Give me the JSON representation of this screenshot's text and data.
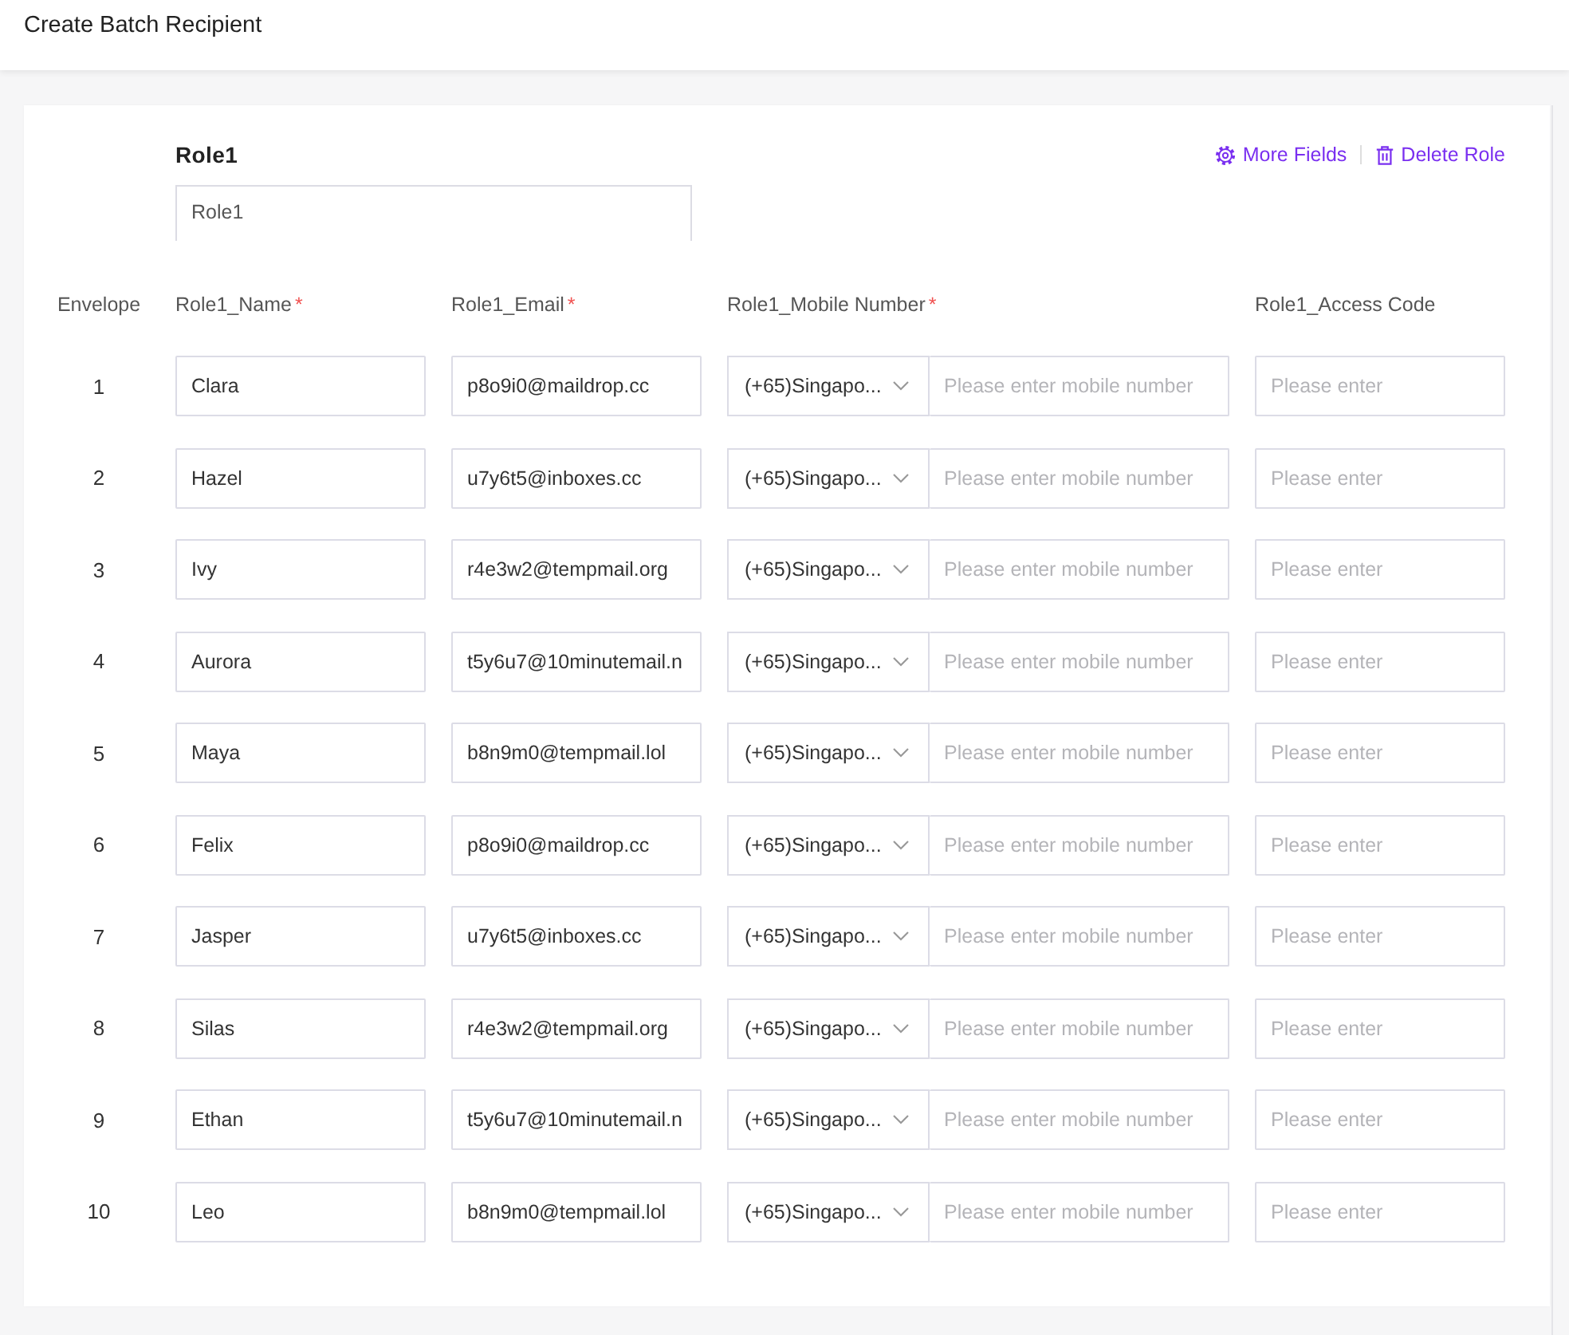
{
  "header": {
    "title": "Create Batch Recipient"
  },
  "role": {
    "label": "Role1",
    "name_field": {
      "value": "Role1"
    },
    "actions": [
      {
        "kind": "settings",
        "label": "More Fields"
      },
      {
        "kind": "delete",
        "label": "Delete Role"
      }
    ]
  },
  "table": {
    "columns": [
      {
        "label": "Envelope"
      },
      {
        "label": "Role1_Name",
        "required_mark": "*"
      },
      {
        "label": "Role1_Email",
        "required_mark": "*"
      },
      {
        "label": "Role1_Mobile Number",
        "required_mark": "*"
      },
      {
        "label": "Role1_Access Code"
      }
    ],
    "rows": [
      {
        "envelope": "1",
        "name": "Clara",
        "email": "p8o9i0@maildrop.cc",
        "country_code": "(+65)Singapo...",
        "mobile": {
          "placeholder": "Please enter mobile number"
        },
        "access_code": {
          "placeholder": "Please enter"
        }
      },
      {
        "envelope": "2",
        "name": "Hazel",
        "email": "u7y6t5@inboxes.cc",
        "country_code": "(+65)Singapo...",
        "mobile": {
          "placeholder": "Please enter mobile number"
        },
        "access_code": {
          "placeholder": "Please enter"
        }
      },
      {
        "envelope": "3",
        "name": "Ivy",
        "email": "r4e3w2@tempmail.org",
        "country_code": "(+65)Singapo...",
        "mobile": {
          "placeholder": "Please enter mobile number"
        },
        "access_code": {
          "placeholder": "Please enter"
        }
      },
      {
        "envelope": "4",
        "name": "Aurora",
        "email": "t5y6u7@10minutemail.n",
        "country_code": "(+65)Singapo...",
        "mobile": {
          "placeholder": "Please enter mobile number"
        },
        "access_code": {
          "placeholder": "Please enter"
        }
      },
      {
        "envelope": "5",
        "name": "Maya",
        "email": "b8n9m0@tempmail.lol",
        "country_code": "(+65)Singapo...",
        "mobile": {
          "placeholder": "Please enter mobile number"
        },
        "access_code": {
          "placeholder": "Please enter"
        }
      },
      {
        "envelope": "6",
        "name": "Felix",
        "email": "p8o9i0@maildrop.cc",
        "country_code": "(+65)Singapo...",
        "mobile": {
          "placeholder": "Please enter mobile number"
        },
        "access_code": {
          "placeholder": "Please enter"
        }
      },
      {
        "envelope": "7",
        "name": "Jasper",
        "email": "u7y6t5@inboxes.cc",
        "country_code": "(+65)Singapo...",
        "mobile": {
          "placeholder": "Please enter mobile number"
        },
        "access_code": {
          "placeholder": "Please enter"
        }
      },
      {
        "envelope": "8",
        "name": "Silas",
        "email": "r4e3w2@tempmail.org",
        "country_code": "(+65)Singapo...",
        "mobile": {
          "placeholder": "Please enter mobile number"
        },
        "access_code": {
          "placeholder": "Please enter"
        }
      },
      {
        "envelope": "9",
        "name": "Ethan",
        "email": "t5y6u7@10minutemail.n",
        "country_code": "(+65)Singapo...",
        "mobile": {
          "placeholder": "Please enter mobile number"
        },
        "access_code": {
          "placeholder": "Please enter"
        }
      },
      {
        "envelope": "10",
        "name": "Leo",
        "email": "b8n9m0@tempmail.lol",
        "country_code": "(+65)Singapo...",
        "mobile": {
          "placeholder": "Please enter mobile number"
        },
        "access_code": {
          "placeholder": "Please enter"
        }
      }
    ]
  }
}
